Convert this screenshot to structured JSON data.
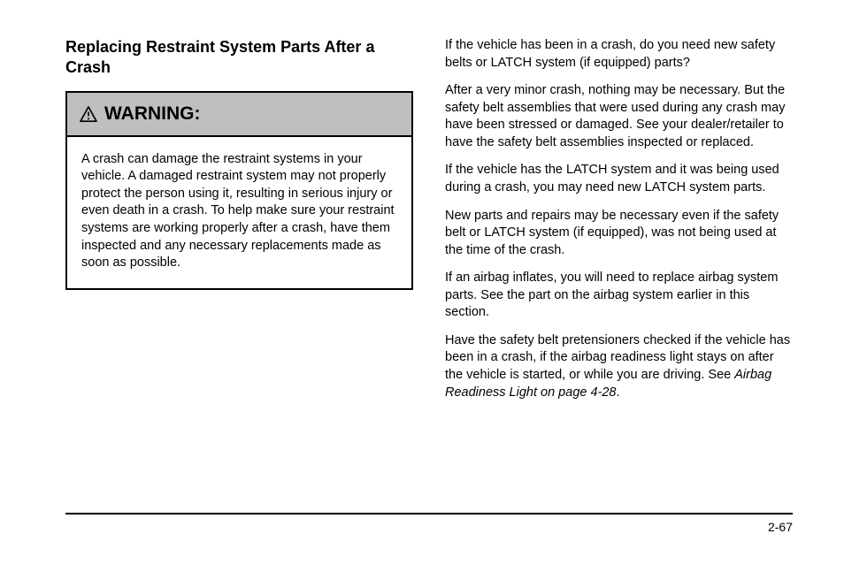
{
  "heading": "Replacing Restraint System Parts After a Crash",
  "warning": {
    "label": "WARNING:",
    "body": "A crash can damage the restraint systems in your vehicle. A damaged restraint system may not properly protect the person using it, resulting in serious injury or even death in a crash. To help make sure your restraint systems are working properly after a crash, have them inspected and any necessary replacements made as soon as possible."
  },
  "paragraphs": [
    "If the vehicle has been in a crash, do you need new safety belts or LATCH system (if equipped) parts?",
    "After a very minor crash, nothing may be necessary. But the safety belt assemblies that were used during any crash may have been stressed or damaged. See your dealer/retailer to have the safety belt assemblies inspected or replaced.",
    "If the vehicle has the LATCH system and it was being used during a crash, you may need new LATCH system parts.",
    "New parts and repairs may be necessary even if the safety belt or LATCH system (if equipped), was not being used at the time of the crash.",
    "If an airbag inflates, you will need to replace airbag system parts. See the part on the airbag system earlier in this section."
  ],
  "last_para": {
    "pre": "Have the safety belt pretensioners checked if the vehicle has been in a crash, if the airbag readiness light stays on after the vehicle is started, or while you are driving. See ",
    "xref_title": "Airbag Readiness Light",
    "xref_page": " on page 4-28",
    "post": "."
  },
  "page_number": "2-67"
}
